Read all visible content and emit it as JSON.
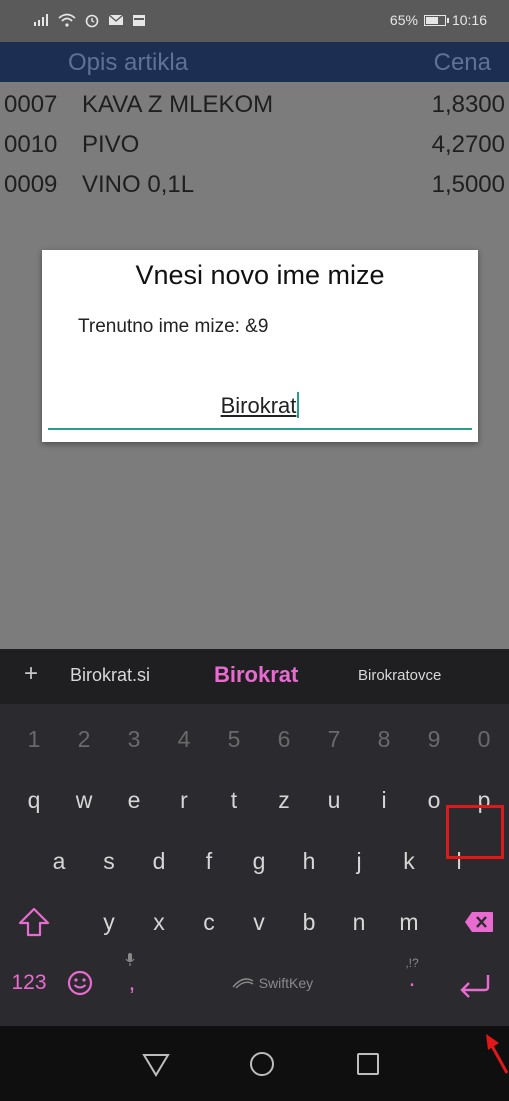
{
  "status_bar": {
    "battery": "65%",
    "time": "10:16",
    "battery_level": 0.65
  },
  "table": {
    "header": {
      "description": "Opis artikla",
      "price": "Cena"
    },
    "rows": [
      {
        "code": "0007",
        "name": "KAVA Z MLEKOM",
        "price": "1,8300"
      },
      {
        "code": "0010",
        "name": "PIVO",
        "price": "4,2700"
      },
      {
        "code": "0009",
        "name": "VINO 0,1L",
        "price": "1,5000"
      }
    ]
  },
  "dialog": {
    "title": "Vnesi novo ime mize",
    "message": "Trenutno ime mize: &9",
    "input_value": "Birokrat"
  },
  "keyboard": {
    "suggestions": {
      "plus": "+",
      "left": "Birokrat.si",
      "center": "Birokrat",
      "right": "Birokratovce"
    },
    "number_row": [
      "1",
      "2",
      "3",
      "4",
      "5",
      "6",
      "7",
      "8",
      "9",
      "0"
    ],
    "row1": [
      "q",
      "w",
      "e",
      "r",
      "t",
      "z",
      "u",
      "i",
      "o",
      "p"
    ],
    "row2": [
      "a",
      "s",
      "d",
      "f",
      "g",
      "h",
      "j",
      "k",
      "l"
    ],
    "row3": [
      "y",
      "x",
      "c",
      "v",
      "b",
      "n",
      "m"
    ],
    "bottom": {
      "numbers_key": "123",
      "comma": ",",
      "space_brand": "SwiftKey",
      "period": ".",
      "period_alt": ",!?"
    }
  },
  "colors": {
    "accent": "#2a9c8c",
    "highlight": "#e01818",
    "suggestion": "#e86bd0"
  }
}
